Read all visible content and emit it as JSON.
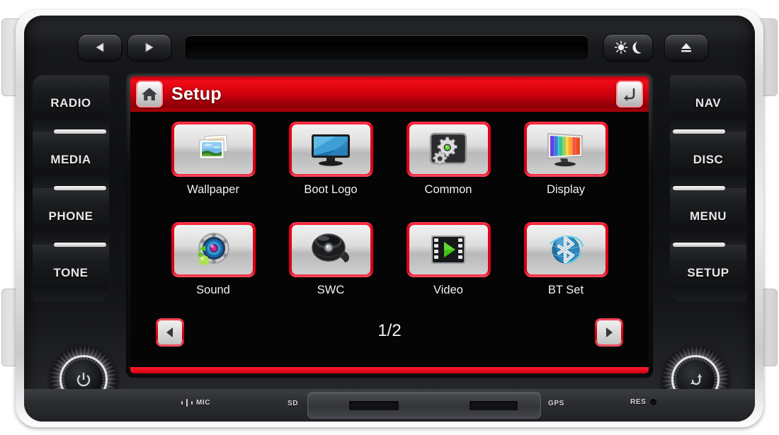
{
  "device": {
    "top_controls": [
      {
        "name": "prev-track",
        "icon": "triangle-left-icon"
      },
      {
        "name": "next-track",
        "icon": "triangle-right-icon"
      },
      {
        "name": "day-night",
        "icon": "sun-moon-icon"
      },
      {
        "name": "eject",
        "icon": "eject-icon"
      }
    ],
    "left_buttons": [
      {
        "label": "RADIO"
      },
      {
        "label": "MEDIA"
      },
      {
        "label": "PHONE"
      },
      {
        "label": "TONE"
      }
    ],
    "right_buttons": [
      {
        "label": "NAV"
      },
      {
        "label": "DISC"
      },
      {
        "label": "MENU"
      },
      {
        "label": "SETUP"
      }
    ],
    "knobs": [
      {
        "name": "power-volume-knob",
        "icon": "power-icon"
      },
      {
        "name": "tune-knob",
        "icon": "rotate-arrow-icon"
      }
    ],
    "bottom_strip": {
      "mic_label": "MIC",
      "sd_label": "SD",
      "gps_label": "GPS",
      "res_label": "RES"
    }
  },
  "screen": {
    "header": {
      "home_icon": "home-icon",
      "title": "Setup",
      "back_icon": "back-arrow-icon"
    },
    "menu_items": [
      {
        "label": "Wallpaper",
        "icon": "photos-icon"
      },
      {
        "label": "Boot Logo",
        "icon": "monitor-blue-icon"
      },
      {
        "label": "Common",
        "icon": "gears-icon"
      },
      {
        "label": "Display",
        "icon": "monitor-rainbow-icon"
      },
      {
        "label": "Sound",
        "icon": "speaker-driver-icon"
      },
      {
        "label": "SWC",
        "icon": "steering-wheel-icon"
      },
      {
        "label": "Video",
        "icon": "film-play-icon"
      },
      {
        "label": "BT Set",
        "icon": "bluetooth-globe-icon"
      }
    ],
    "pager": {
      "prev_icon": "triangle-left-icon",
      "next_icon": "triangle-right-icon",
      "indicator": "1/2"
    }
  },
  "colors": {
    "accent_red": "#e00017",
    "header_red": "#d2000c",
    "screen_bg": "#050505",
    "text_light": "#f2f2f2"
  }
}
